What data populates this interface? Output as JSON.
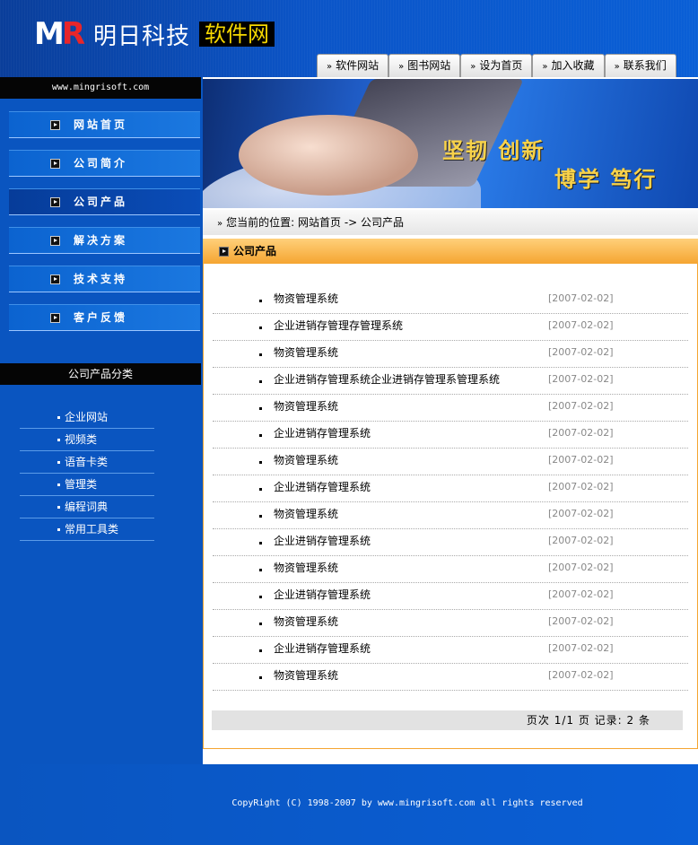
{
  "header": {
    "logo_mark_main": "M",
    "logo_mark_accent": "R",
    "logo_cn": "明日科技",
    "logo_box": "软件网",
    "tabs": [
      {
        "label": "软件网站"
      },
      {
        "label": "图书网站"
      },
      {
        "label": "设为首页"
      },
      {
        "label": "加入收藏"
      },
      {
        "label": "联系我们"
      }
    ]
  },
  "sidebar": {
    "url": "www.mingrisoft.com",
    "menu": [
      {
        "label": "网站首页"
      },
      {
        "label": "公司简介"
      },
      {
        "label": "公司产品",
        "active": true
      },
      {
        "label": "解决方案"
      },
      {
        "label": "技术支持"
      },
      {
        "label": "客户反馈"
      }
    ],
    "category_title": "公司产品分类",
    "categories": [
      {
        "label": "企业网站"
      },
      {
        "label": "视频类"
      },
      {
        "label": "语音卡类"
      },
      {
        "label": "管理类"
      },
      {
        "label": "编程词典"
      },
      {
        "label": "常用工具类"
      }
    ]
  },
  "banner": {
    "slogan_1": "坚韧 创新",
    "slogan_2": "博学 笃行"
  },
  "breadcrumb": {
    "prefix": "您当前的位置:",
    "path": "网站首页 -> 公司产品"
  },
  "section": {
    "title": "公司产品"
  },
  "products": [
    {
      "title": "物资管理系统",
      "date": "[2007-02-02]"
    },
    {
      "title": "企业进销存管理存管理系统",
      "date": "[2007-02-02]"
    },
    {
      "title": "物资管理系统",
      "date": "[2007-02-02]"
    },
    {
      "title": "企业进销存管理系统企业进销存管理系管理系统",
      "date": "[2007-02-02]"
    },
    {
      "title": "物资管理系统",
      "date": "[2007-02-02]"
    },
    {
      "title": "企业进销存管理系统",
      "date": "[2007-02-02]"
    },
    {
      "title": "物资管理系统",
      "date": "[2007-02-02]"
    },
    {
      "title": "企业进销存管理系统",
      "date": "[2007-02-02]"
    },
    {
      "title": "物资管理系统",
      "date": "[2007-02-02]"
    },
    {
      "title": "企业进销存管理系统",
      "date": "[2007-02-02]"
    },
    {
      "title": "物资管理系统",
      "date": "[2007-02-02]"
    },
    {
      "title": "企业进销存管理系统",
      "date": "[2007-02-02]"
    },
    {
      "title": "物资管理系统",
      "date": "[2007-02-02]"
    },
    {
      "title": "企业进销存管理系统",
      "date": "[2007-02-02]"
    },
    {
      "title": "物资管理系统",
      "date": "[2007-02-02]"
    }
  ],
  "pager": {
    "text": "页次 1/1 页  记录: 2 条"
  },
  "footer": {
    "copyright": "CopyRight (C) 1998-2007 by www.mingrisoft.com all rights reserved"
  },
  "colors": {
    "brand_blue": "#0a55c0",
    "section_orange": "#f5a531",
    "slogan_yellow": "#f8d24a"
  }
}
